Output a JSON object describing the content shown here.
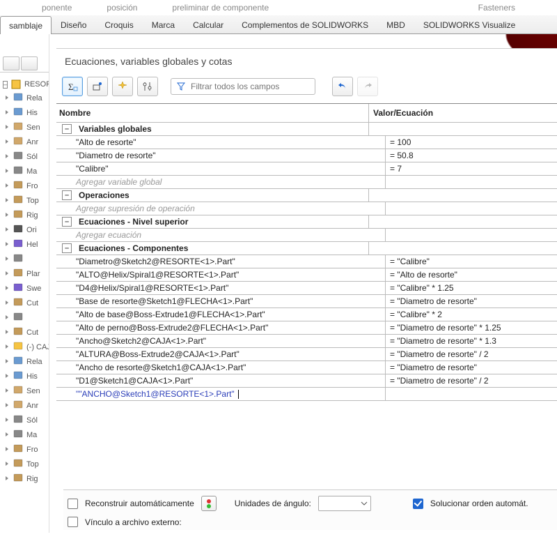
{
  "top_faded": [
    "ponente",
    "posición",
    "preliminar de componente",
    "Fasteners"
  ],
  "ribbon": {
    "tabs": [
      "samblaje",
      "Diseño",
      "Croquis",
      "Marca",
      "Calcular",
      "Complementos de SOLIDWORKS",
      "MBD",
      "SOLIDWORKS Visualize"
    ],
    "active_index": 0
  },
  "tree": {
    "root": "RESOR",
    "items": [
      "Rela",
      "His",
      "Sen",
      "Anr",
      "Sól",
      "Ma",
      "Fro",
      "Top",
      "Rig",
      "Ori",
      "Hel",
      "",
      "Plar",
      "Swe",
      "Cut",
      "",
      "Cut",
      "(-) CAJ",
      "Rela",
      "His",
      "Sen",
      "Anr",
      "Sól",
      "Ma",
      "Fro",
      "Top",
      "Rig"
    ]
  },
  "dialog": {
    "title": "Ecuaciones, variables globales y cotas",
    "filter_placeholder": "Filtrar todos los campos",
    "columns": {
      "name": "Nombre",
      "value": "Valor/Ecuación"
    },
    "sections": {
      "globals": {
        "title": "Variables globales",
        "rows": [
          {
            "name": "\"Alto de resorte\"",
            "value": "= 100"
          },
          {
            "name": "\"Diametro de resorte\"",
            "value": "= 50.8"
          },
          {
            "name": "\"Calibre\"",
            "value": "= 7"
          }
        ],
        "placeholder": "Agregar variable global"
      },
      "ops": {
        "title": "Operaciones",
        "placeholder": "Agregar supresión de operación"
      },
      "eq_top": {
        "title": "Ecuaciones - Nivel superior",
        "placeholder": "Agregar ecuación"
      },
      "eq_comp": {
        "title": "Ecuaciones - Componentes",
        "rows": [
          {
            "name": "\"Diametro@Sketch2@RESORTE<1>.Part\"",
            "value": "= \"Calibre\""
          },
          {
            "name": "\"ALTO@Helix/Spiral1@RESORTE<1>.Part\"",
            "value": "= \"Alto de resorte\""
          },
          {
            "name": "\"D4@Helix/Spiral1@RESORTE<1>.Part\"",
            "value": "= \"Calibre\" * 1.25"
          },
          {
            "name": "\"Base de resorte@Sketch1@FLECHA<1>.Part\"",
            "value": "= \"Diametro de resorte\""
          },
          {
            "name": "\"Alto de base@Boss-Extrude1@FLECHA<1>.Part\"",
            "value": "= \"Calibre\" * 2"
          },
          {
            "name": "\"Alto de perno@Boss-Extrude2@FLECHA<1>.Part\"",
            "value": "= \"Diametro de resorte\" * 1.25"
          },
          {
            "name": "\"Ancho@Sketch2@CAJA<1>.Part\"",
            "value": "= \"Diametro de resorte\" * 1.3"
          },
          {
            "name": "\"ALTURA@Boss-Extrude2@CAJA<1>.Part\"",
            "value": "= \"Diametro de resorte\" / 2"
          },
          {
            "name": "\"Ancho de resorte@Sketch1@CAJA<1>.Part\"",
            "value": "= \"Diametro de resorte\""
          },
          {
            "name": "\"D1@Sketch1@CAJA<1>.Part\"",
            "value": "= \"Diametro de resorte\" / 2"
          }
        ],
        "editing": "\"\"ANCHO@Sketch1@RESORTE<1>.Part\""
      }
    }
  },
  "bottom": {
    "rebuild": "Reconstruir automáticamente",
    "angle_label": "Unidades de ángulo:",
    "solve_order": "Solucionar orden automát.",
    "link_ext": "Vínculo a archivo externo:"
  }
}
